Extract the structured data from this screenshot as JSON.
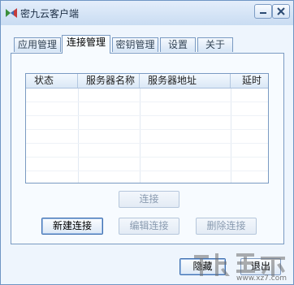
{
  "window": {
    "title": "密九云客户端"
  },
  "tabs": [
    {
      "label": "应用管理",
      "active": false
    },
    {
      "label": "连接管理",
      "active": true
    },
    {
      "label": "密钥管理",
      "active": false
    },
    {
      "label": "设置",
      "active": false
    },
    {
      "label": "关于",
      "active": false
    }
  ],
  "list": {
    "columns": [
      "状态",
      "服务器名称",
      "服务器地址",
      "延时"
    ],
    "rows": []
  },
  "buttons": {
    "connect": "连接",
    "new_connection": "新建连接",
    "edit_connection": "编辑连接",
    "delete_connection": "删除连接",
    "hide": "隐藏",
    "exit": "退出"
  },
  "watermark": {
    "text": "www.xz7.com"
  },
  "colors": {
    "accent": "#7a9ac2",
    "window_bg": "#eef5fd",
    "titlebar": "#c9dcf2"
  }
}
